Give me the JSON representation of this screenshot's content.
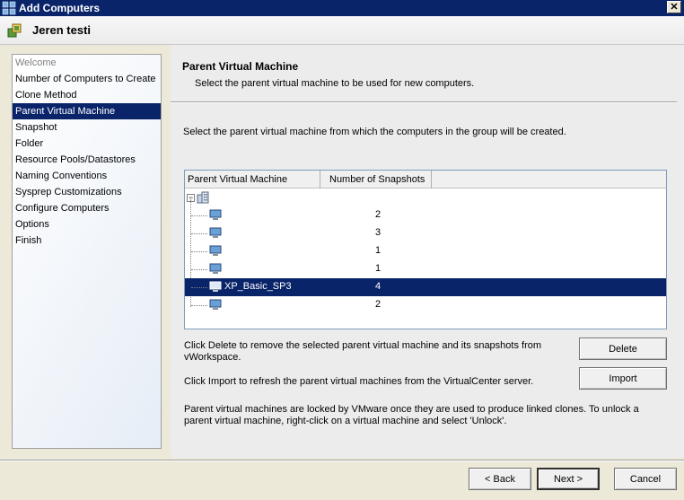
{
  "window": {
    "title": "Add Computers",
    "close_glyph": "✕"
  },
  "header": {
    "title": "Jeren testi"
  },
  "nav": {
    "items": [
      {
        "label": "Welcome",
        "state": "disabled"
      },
      {
        "label": "Number of Computers to Create",
        "state": "normal"
      },
      {
        "label": "Clone Method",
        "state": "normal"
      },
      {
        "label": "Parent Virtual Machine",
        "state": "selected"
      },
      {
        "label": "Snapshot",
        "state": "normal"
      },
      {
        "label": "Folder",
        "state": "normal"
      },
      {
        "label": "Resource Pools/Datastores",
        "state": "normal"
      },
      {
        "label": "Naming Conventions",
        "state": "normal"
      },
      {
        "label": "Sysprep Customizations",
        "state": "normal"
      },
      {
        "label": "Configure Computers",
        "state": "normal"
      },
      {
        "label": "Options",
        "state": "normal"
      },
      {
        "label": "Finish",
        "state": "normal"
      }
    ]
  },
  "main": {
    "title": "Parent Virtual Machine",
    "subtitle": "Select the parent virtual machine to be used for new computers.",
    "instruction": "Select the parent virtual machine from which the computers in the group will be created.",
    "grid": {
      "columns": [
        "Parent Virtual Machine",
        "Number of Snapshots"
      ],
      "rows": [
        {
          "name": "",
          "snapshots": "2"
        },
        {
          "name": "",
          "snapshots": "3"
        },
        {
          "name": "",
          "snapshots": "1"
        },
        {
          "name": "",
          "snapshots": "1"
        },
        {
          "name": "XP_Basic_SP3",
          "snapshots": "4",
          "selected": true
        },
        {
          "name": "",
          "snapshots": "2"
        }
      ]
    },
    "delete_info": "Click Delete to remove the selected parent virtual machine and its snapshots from vWorkspace.",
    "import_info": "Click Import to refresh the parent virtual machines from the VirtualCenter server.",
    "lock_info": "Parent virtual machines are locked by VMware once they are used to produce linked clones.  To unlock a parent virtual machine, right-click on a virtual machine and select 'Unlock'.",
    "delete_label": "Delete",
    "import_label": "Import"
  },
  "footer": {
    "back_label": "< Back",
    "next_label": "Next >",
    "cancel_label": "Cancel"
  },
  "colors": {
    "titlebar": "#0a246a",
    "selection": "#0a246a"
  }
}
